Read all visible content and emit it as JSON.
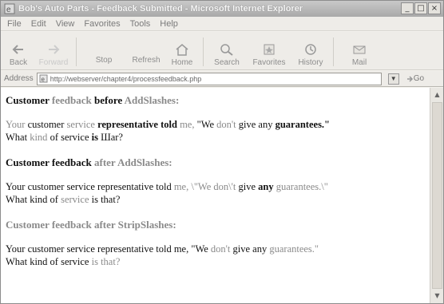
{
  "window": {
    "title": "Bob's Auto Parts - Feedback Submitted - Microsoft Internet Explorer",
    "controls": {
      "minimize": "_",
      "maximize": "□",
      "close": "×"
    }
  },
  "menu": [
    "File",
    "Edit",
    "View",
    "Favorites",
    "Tools",
    "Help"
  ],
  "toolbar": {
    "back": "Back",
    "forward": "Forward",
    "stop": "Stop",
    "refresh": "Refresh",
    "home": "Home",
    "search": "Search",
    "favorites": "Favorites",
    "history": "History",
    "mail": "Mail"
  },
  "address": {
    "label": "Address",
    "url": "http://webserver/chapter4/processfeedback.php",
    "go": "Go"
  },
  "content": {
    "h1": {
      "a": "Customer ",
      "b": "feedback",
      "c": " before ",
      "d": "AddSlashes:"
    },
    "p1": {
      "a": "Your",
      "b": " customer ",
      "c": "service",
      "d": " representative told ",
      "e": "me,",
      "f": " \"We ",
      "g": "don't",
      "h": " give any ",
      "i": "guarantees.\"",
      "j": "What ",
      "k": "kind",
      "l": " of service ",
      "m": "is",
      "n": " Шar?"
    },
    "h2": {
      "a": "Customer feedback ",
      "b": "after AddSlashes:"
    },
    "p2": {
      "a": "Your customer service representative told ",
      "b": "me, \\\"We don\\'t",
      "c": " give ",
      "d": "any",
      "e": " guarantees.\\\"",
      "f": "What kind of ",
      "g": "service",
      "h": " is that?"
    },
    "h3": {
      "a": "Customer feedback after StripSlashes:"
    },
    "p3": {
      "a": "Your customer service representative told me, \"We ",
      "b": "don't",
      "c": " give any ",
      "d": "guarantees.\"",
      "e": "What kind of service ",
      "f": "is that?"
    }
  },
  "colors": {
    "faded_text": "#8a8a8a",
    "title_gradient_top": "#c9c9c9"
  },
  "icons": [
    "ie-logo-icon",
    "back-icon",
    "forward-icon",
    "home-icon",
    "search-icon",
    "favorites-icon",
    "history-icon",
    "mail-icon",
    "page-icon",
    "go-arrow-icon"
  ]
}
